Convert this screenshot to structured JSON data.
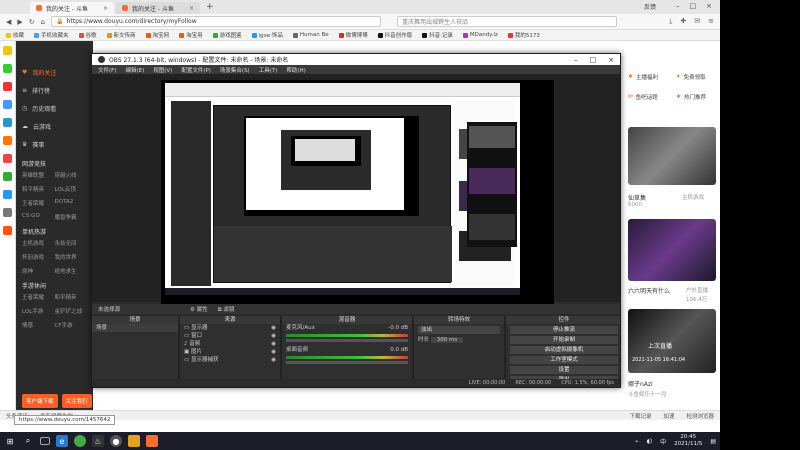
{
  "browser": {
    "tab_active": "我的关注 - 斗鱼",
    "tab_inactive": "我的关注 - 斗鱼",
    "url": "https://www.douyu.com/directory/myFollow",
    "search_placeholder": "重庆舞用出城野生人获品",
    "account": "反馈",
    "bookmarks": [
      "收藏",
      "手机收藏夹",
      "谷歌",
      "新文传商",
      "淘宝网",
      "淘宝用",
      "游戏图鉴",
      "igxe·饰品",
      "Human Be",
      "微博博博",
      "抖音创作版",
      "抖音·记录",
      "MDandy.lz",
      "我的5173"
    ]
  },
  "douyu": {
    "nav": [
      {
        "label": "我的关注",
        "icon": "heart-icon"
      },
      {
        "label": "排行榜",
        "icon": "list-icon"
      },
      {
        "label": "历史观看",
        "icon": "history-icon"
      },
      {
        "label": "云游戏",
        "icon": "cloud-icon"
      },
      {
        "label": "赛事",
        "icon": "trophy-icon"
      }
    ],
    "section1_title": "网游竞技",
    "section1_items": [
      "英雄联盟",
      "穿越火线",
      "和平精英",
      "LOL云顶",
      "王者荣耀",
      "DOTA2",
      "CS:GO",
      "魔兽争霸"
    ],
    "section2_title": "单机热游",
    "section2_items": [
      "主机游戏",
      "永劫无间",
      "怀旧游戏",
      "我的世界",
      "原神",
      "绝地求生"
    ],
    "section3_title": "手游休闲",
    "section3_items": [
      "王者荣耀",
      "和平精英",
      "LOL手游",
      "金铲铲之战",
      "情感",
      "CF手游"
    ],
    "btn_left": "客户端下载",
    "btn_right": "关注我们",
    "right_links": [
      {
        "label": "主播福利",
        "icon": "gift-icon"
      },
      {
        "label": "免费领取",
        "icon": "coupon-icon"
      },
      {
        "label": "鱼吧话题",
        "icon": "chat-icon"
      },
      {
        "label": "热门推荐",
        "icon": "star-icon"
      }
    ],
    "card1_name": "仙草集",
    "card1_meta": "主机游戏",
    "card1_views": "6000",
    "card2_name": "六六明天有什么",
    "card2_meta": "户外直播",
    "card2_views": "106.4万",
    "card3_tag": "上次直播",
    "card3_date": "2021-11-05 16:41:04",
    "card3_name": "娜子nAzi",
    "card3_sub": "斗鱼娱乐十一月"
  },
  "obs": {
    "title": "OBS 27.1.3 (64-bit, windows) - 配置文件: 未命名 - 场景: 未命名",
    "menu": [
      "文件(F)",
      "编辑(E)",
      "视图(V)",
      "配置文件(P)",
      "场景集合(S)",
      "工具(T)",
      "帮助(H)"
    ],
    "source_bar": "未选择源",
    "btn_props": "属性",
    "btn_filter": "滤镜",
    "docks": {
      "scenes": {
        "title": "场景",
        "items": [
          "场景"
        ]
      },
      "sources": {
        "title": "来源",
        "items": [
          "显示器",
          "窗口",
          "音频",
          "图片",
          "显示器捕获"
        ]
      },
      "mixer": {
        "title": "混音器",
        "ch1": "麦克风/Aux",
        "ch2": "桌面音频",
        "db1": "-0.0 dB",
        "db2": "0.0 dB"
      },
      "transitions": {
        "title": "转场特效",
        "type": "淡出",
        "duration_label": "时长",
        "duration": "300 ms"
      },
      "controls": {
        "title": "控件",
        "buttons": [
          "停止推流",
          "开始录制",
          "启动虚拟摄像机",
          "工作室模式",
          "设置",
          "退出"
        ]
      }
    },
    "status": {
      "live": "LIVE: 00:00:00",
      "rec": "REC: 00:00:00",
      "cpu": "CPU: 1.5%, 60.00 fps"
    }
  },
  "page_status": {
    "url_hint": "https://www.douyu.com/1457642",
    "items": [
      "头条资讯",
      "看新闻要为你",
      "下载记录",
      "加速",
      "检测浏览器"
    ]
  },
  "taskbar": {
    "time": "20:45",
    "date": "2021/11/5",
    "lang": "中",
    "search_hint": "搜索"
  }
}
